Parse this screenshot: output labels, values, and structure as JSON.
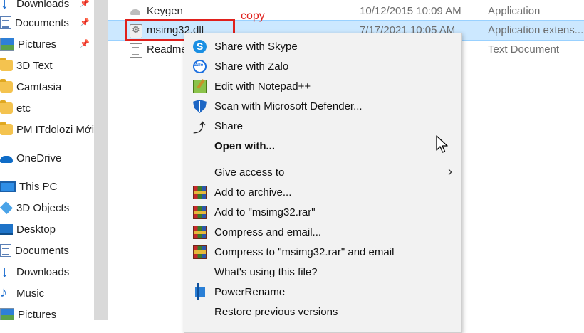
{
  "sidebar": {
    "items": [
      {
        "label": "Downloads",
        "icon": "download-icon",
        "pinned": true
      },
      {
        "label": "Documents",
        "icon": "document-icon",
        "pinned": true
      },
      {
        "label": "Pictures",
        "icon": "pictures-icon",
        "pinned": true
      },
      {
        "label": "3D Text",
        "icon": "folder-icon",
        "pinned": false
      },
      {
        "label": "Camtasia",
        "icon": "folder-icon",
        "pinned": false
      },
      {
        "label": "etc",
        "icon": "folder-icon",
        "pinned": false
      },
      {
        "label": "PM ITdolozi Mới",
        "icon": "folder-icon",
        "pinned": false
      },
      {
        "label": "OneDrive",
        "icon": "cloud-icon",
        "pinned": false
      },
      {
        "label": "This PC",
        "icon": "computer-icon",
        "pinned": false
      },
      {
        "label": "3D Objects",
        "icon": "cube-icon",
        "pinned": false
      },
      {
        "label": "Desktop",
        "icon": "desktop-icon",
        "pinned": false
      },
      {
        "label": "Documents",
        "icon": "document-icon",
        "pinned": false
      },
      {
        "label": "Downloads",
        "icon": "download-icon",
        "pinned": false
      },
      {
        "label": "Music",
        "icon": "music-icon",
        "pinned": false
      },
      {
        "label": "Pictures",
        "icon": "pictures-icon",
        "pinned": false
      }
    ]
  },
  "files": [
    {
      "name": "Keygen",
      "date": "10/12/2015 10:09 AM",
      "type": "Application"
    },
    {
      "name": "msimg32.dll",
      "date": "7/17/2021 10:05 AM",
      "type": "Application extens..."
    },
    {
      "name": "Readme",
      "date": "",
      "type": "Text Document"
    }
  ],
  "annotation": {
    "label": "copy",
    "color": "#e0201c"
  },
  "context_menu": {
    "items": [
      {
        "label": "Share with Skype",
        "icon": "skype-icon"
      },
      {
        "label": "Share with Zalo",
        "icon": "zalo-icon"
      },
      {
        "label": "Edit with Notepad++",
        "icon": "notepad-plus-plus-icon"
      },
      {
        "label": "Scan with Microsoft Defender...",
        "icon": "defender-shield-icon"
      },
      {
        "label": "Share",
        "icon": "share-icon"
      },
      {
        "label": "Open with...",
        "icon": "",
        "bold": true
      },
      {
        "label": "Give access to",
        "icon": "",
        "submenu": true
      },
      {
        "label": "Add to archive...",
        "icon": "winrar-icon"
      },
      {
        "label": "Add to \"msimg32.rar\"",
        "icon": "winrar-icon"
      },
      {
        "label": "Compress and email...",
        "icon": "winrar-icon"
      },
      {
        "label": "Compress to \"msimg32.rar\" and email",
        "icon": "winrar-icon"
      },
      {
        "label": "What's using this file?",
        "icon": ""
      },
      {
        "label": "PowerRename",
        "icon": "power-rename-icon"
      },
      {
        "label": "Restore previous versions",
        "icon": ""
      }
    ]
  },
  "colors": {
    "selection": "#cce8ff",
    "menu_bg": "#f2f2f2",
    "annotation_red": "#e0201c"
  }
}
